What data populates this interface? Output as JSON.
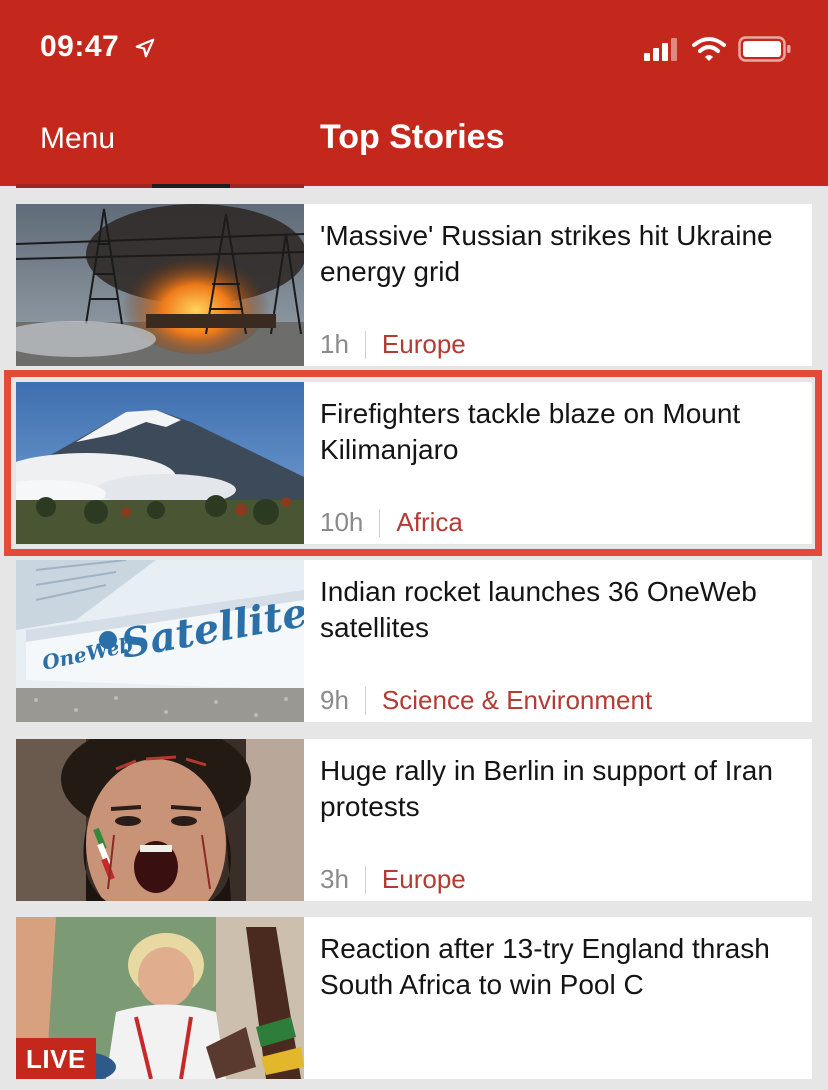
{
  "status_bar": {
    "time": "09:47",
    "icons": [
      "location-arrow-icon",
      "cellular-signal-icon",
      "wifi-icon",
      "battery-icon"
    ]
  },
  "nav": {
    "menu_label": "Menu",
    "title": "Top Stories"
  },
  "colors": {
    "brand_red": "#c4281c",
    "section_red": "#b43b33",
    "highlight": "#e34a3a"
  },
  "stories": [
    {
      "headline": "'Massive' Russian strikes hit Ukraine energy grid",
      "time": "1h",
      "section": "Europe"
    },
    {
      "headline": "Firefighters tackle blaze on Mount Kilimanjaro",
      "time": "10h",
      "section": "Africa"
    },
    {
      "headline": "Indian rocket launches 36 OneWeb satellites",
      "time": "9h",
      "section": "Science & Environment"
    },
    {
      "headline": "Huge rally in Berlin in support of Iran protests",
      "time": "3h",
      "section": "Europe"
    },
    {
      "headline": "Reaction after 13-try England thrash South Africa to win Pool C",
      "badge": "LIVE"
    }
  ]
}
